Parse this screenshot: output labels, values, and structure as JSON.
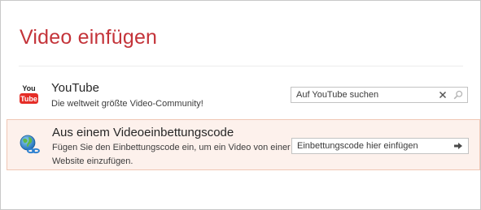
{
  "dialog": {
    "title": "Video einfügen"
  },
  "sources": {
    "youtube": {
      "icon": "youtube-logo-icon",
      "logo_text_top": "You",
      "logo_text_bottom": "Tube",
      "title": "YouTube",
      "description": "Die weltweit größte Video-Community!",
      "search_placeholder": "Auf YouTube suchen",
      "clear_icon": "close-icon",
      "search_icon": "search-icon"
    },
    "embed": {
      "icon": "globe-link-icon",
      "title": "Aus einem Videoeinbettungscode",
      "description": "Fügen Sie den Einbettungscode ein, um ein Video von einer Website einzufügen.",
      "input_placeholder": "Einbettungscode hier einfügen",
      "go_icon": "arrow-right-icon"
    }
  },
  "colors": {
    "title": "#c4343a",
    "selected_row_bg": "#fdf1ec",
    "selected_row_border": "#f0c7b5",
    "youtube_red": "#e52d27"
  }
}
